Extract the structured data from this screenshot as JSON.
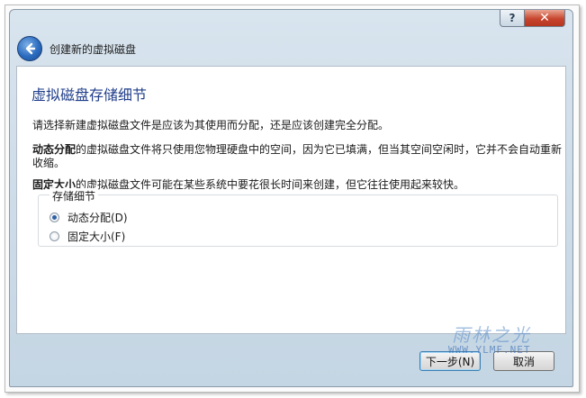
{
  "titlebar": {
    "help_label": "?",
    "close_label": "✕"
  },
  "nav": {
    "title": "创建新的虚拟磁盘"
  },
  "page": {
    "heading": "虚拟磁盘存储细节",
    "intro": "请选择新建虚拟磁盘文件是应该为其使用而分配，还是应该创建完全分配。",
    "dynamic_bold": "动态分配",
    "dynamic_rest": "的虚拟磁盘文件将只使用您物理硬盘中的空间，因为它已填满，但当其空间空闲时，它并不会自动重新收缩。",
    "fixed_bold": "固定大小",
    "fixed_rest": "的虚拟磁盘文件可能在某些系统中要花很长时间来创建，但它往往使用起来较快。"
  },
  "storage_group": {
    "legend": "存储细节",
    "options": [
      {
        "label": "动态分配(D)",
        "selected": true
      },
      {
        "label": "固定大小(F)",
        "selected": false
      }
    ]
  },
  "footer": {
    "next_label": "下一步(N)",
    "cancel_label": "取消"
  },
  "watermark": {
    "main": "雨林之光",
    "sub": "WWW.YLMF.NET"
  },
  "colors": {
    "heading": "#1f3d8a",
    "close_button": "#c7462e",
    "accent_back": "#2b6cc0"
  },
  "icons": {
    "back": "back-arrow-icon"
  }
}
